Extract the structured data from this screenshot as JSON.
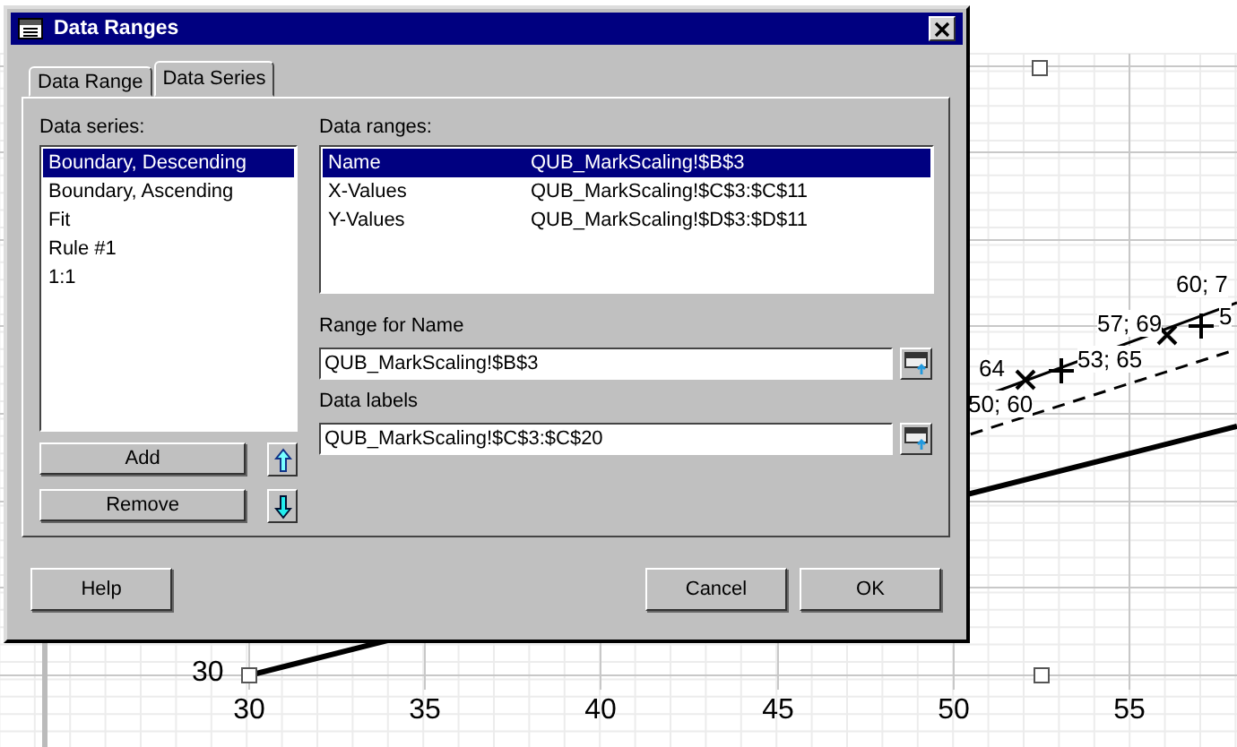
{
  "chart": {
    "xtick_labels": [
      "30",
      "35",
      "40",
      "45",
      "50",
      "55"
    ],
    "ytick_labels": [
      "30"
    ],
    "point_labels": [
      {
        "text": "60; 7"
      },
      {
        "text": "57; 69"
      },
      {
        "text": "5"
      },
      {
        "text": "64"
      },
      {
        "text": "53; 65"
      },
      {
        "text": "50; 60"
      }
    ]
  },
  "window": {
    "title": "Data Ranges"
  },
  "tabs": [
    {
      "label": "Data Range",
      "selected": false
    },
    {
      "label": "Data Series",
      "selected": true
    }
  ],
  "series": {
    "label": "Data series:",
    "items": [
      {
        "label": "Boundary, Descending",
        "selected": true
      },
      {
        "label": "Boundary, Ascending",
        "selected": false
      },
      {
        "label": "Fit",
        "selected": false
      },
      {
        "label": "Rule #1",
        "selected": false
      },
      {
        "label": "1:1",
        "selected": false
      }
    ]
  },
  "ranges": {
    "label": "Data ranges:",
    "rows": [
      {
        "role": "Name",
        "range": "QUB_MarkScaling!$B$3",
        "selected": true
      },
      {
        "role": "X-Values",
        "range": "QUB_MarkScaling!$C$3:$C$11",
        "selected": false
      },
      {
        "role": "Y-Values",
        "range": "QUB_MarkScaling!$D$3:$D$11",
        "selected": false
      }
    ]
  },
  "range_for_name": {
    "label": "Range for Name",
    "value": "QUB_MarkScaling!$B$3"
  },
  "data_labels": {
    "label": "Data labels",
    "value": "QUB_MarkScaling!$C$3:$C$20"
  },
  "series_buttons": [
    "Add",
    "Remove"
  ],
  "buttons": {
    "help": "Help",
    "cancel": "Cancel",
    "ok": "OK"
  }
}
